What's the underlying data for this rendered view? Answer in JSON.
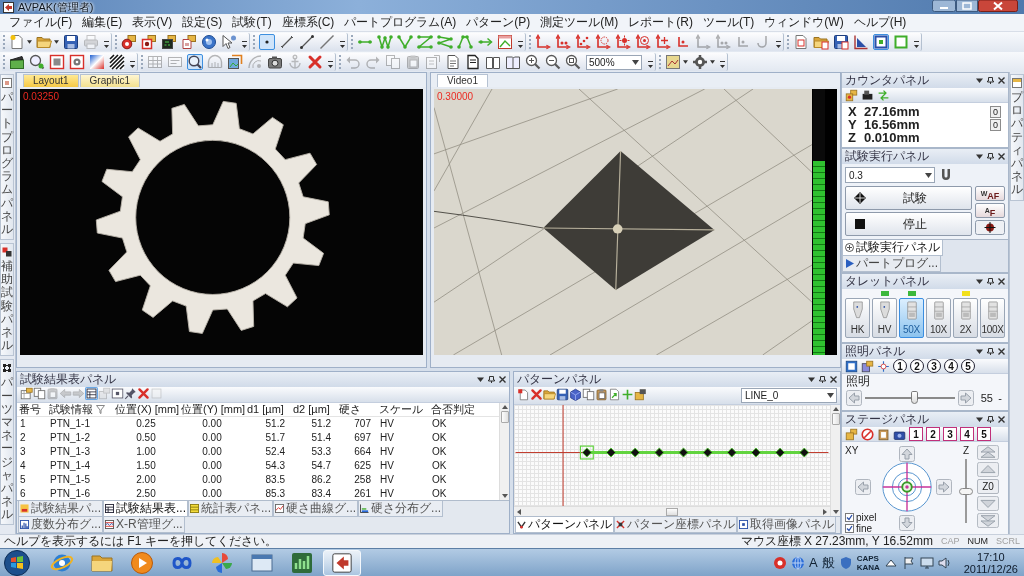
{
  "window": {
    "title": "AVPAK(管理者)"
  },
  "menu": [
    "ファイル(F)",
    "編集(E)",
    "表示(V)",
    "設定(S)",
    "試験(T)",
    "座標系(C)",
    "パートプログラム(A)",
    "パターン(P)",
    "測定ツール(M)",
    "レポート(R)",
    "ツール(T)",
    "ウィンドウ(W)",
    "ヘルプ(H)"
  ],
  "toolbars": [
    {
      "buttons": [
        {
          "selected": false,
          "disabled": false
        },
        {
          "selected": false,
          "disabled": false
        },
        {
          "selected": false,
          "disabled": false
        },
        {
          "selected": false,
          "disabled": true
        },
        {
          "selected": false,
          "disabled": false
        },
        {
          "selected": false,
          "disabled": false
        },
        {
          "selected": false,
          "disabled": false
        },
        {
          "selected": false,
          "disabled": false
        },
        {
          "selected": false,
          "disabled": false
        },
        {
          "selected": false,
          "disabled": false
        },
        {
          "selected": true,
          "disabled": false
        },
        {
          "selected": false,
          "disabled": false
        },
        {
          "selected": false,
          "disabled": false
        },
        {
          "selected": false,
          "disabled": false
        },
        {
          "selected": false,
          "disabled": false
        },
        {
          "selected": false,
          "disabled": false
        },
        {
          "selected": false,
          "disabled": false
        },
        {
          "selected": false,
          "disabled": false
        },
        {
          "selected": false,
          "disabled": false
        },
        {
          "selected": false,
          "disabled": false
        },
        {
          "selected": false,
          "disabled": false
        },
        {
          "selected": false,
          "disabled": false
        },
        {
          "selected": false,
          "disabled": false
        },
        {
          "selected": false,
          "disabled": false
        },
        {
          "selected": false,
          "disabled": false
        },
        {
          "selected": false,
          "disabled": false
        },
        {
          "selected": false,
          "disabled": false
        },
        {
          "selected": false,
          "disabled": false
        },
        {
          "selected": false,
          "disabled": false
        },
        {
          "selected": false,
          "disabled": false
        },
        {
          "selected": false,
          "disabled": true
        },
        {
          "selected": false,
          "disabled": true
        },
        {
          "selected": false,
          "disabled": true
        },
        {
          "selected": false,
          "disabled": true
        },
        {
          "selected": false,
          "disabled": false
        },
        {
          "selected": false,
          "disabled": false
        },
        {
          "selected": false,
          "disabled": false
        },
        {
          "selected": false,
          "disabled": false
        },
        {
          "selected": true,
          "disabled": false
        },
        {
          "selected": false,
          "disabled": false
        }
      ]
    },
    {
      "buttons": [
        {
          "selected": false,
          "disabled": false
        },
        {
          "selected": false,
          "disabled": false
        },
        {
          "selected": false,
          "disabled": false
        },
        {
          "selected": false,
          "disabled": false
        },
        {
          "selected": false,
          "disabled": false
        },
        {
          "selected": false,
          "disabled": false
        },
        {
          "selected": false,
          "disabled": true
        },
        {
          "selected": false,
          "disabled": true
        },
        {
          "selected": true,
          "disabled": false
        },
        {
          "selected": false,
          "disabled": true
        },
        {
          "selected": false,
          "disabled": false
        },
        {
          "selected": false,
          "disabled": true
        },
        {
          "selected": false,
          "disabled": false
        },
        {
          "selected": false,
          "disabled": true
        },
        {
          "selected": false,
          "disabled": false
        },
        {
          "selected": false,
          "disabled": true
        },
        {
          "selected": false,
          "disabled": true
        },
        {
          "selected": false,
          "disabled": true
        },
        {
          "selected": false,
          "disabled": true
        },
        {
          "selected": false,
          "disabled": true
        },
        {
          "selected": false,
          "disabled": false
        },
        {
          "selected": false,
          "disabled": false
        },
        {
          "selected": false,
          "disabled": false
        },
        {
          "selected": false,
          "disabled": false
        },
        {
          "selected": false,
          "disabled": false
        },
        {
          "selected": false,
          "disabled": false
        },
        {
          "selected": false,
          "disabled": false
        },
        {
          "selected": false,
          "disabled": false
        },
        {
          "selected": false,
          "disabled": false
        }
      ],
      "zoom_select": {
        "value": "500%"
      }
    }
  ],
  "left_dock": {
    "tabs": [
      {
        "label": "パートプログラムパネル"
      },
      {
        "label": "補助試験パネル"
      },
      {
        "label": "パーツマネージャパネル"
      }
    ]
  },
  "right_dock": {
    "tabs": [
      {
        "label": "プロパティパネル"
      }
    ]
  },
  "image_window": {
    "focused": true,
    "tabs": [
      {
        "label": "Layout1",
        "selected": true
      },
      {
        "label": "Graphic1",
        "selected": false
      }
    ],
    "readout": "0.03250"
  },
  "video_window": {
    "focused": false,
    "tabs": [
      {
        "label": "Video1",
        "selected": true
      }
    ],
    "readout": "0.30000",
    "focus_meter": {
      "level": 0.73
    }
  },
  "counter_panel": {
    "title": "カウンタパネル",
    "axes": [
      {
        "axis": "X",
        "value": "27.16mm",
        "reset": "0"
      },
      {
        "axis": "Y",
        "value": "16.56mm",
        "reset": "0"
      },
      {
        "axis": "Z",
        "value": "0.010mm"
      }
    ]
  },
  "test_panel": {
    "title": "試験実行パネル",
    "load_select": {
      "value": "0.3"
    },
    "actions": [
      {
        "kind": "start",
        "label": "試験"
      },
      {
        "kind": "stop",
        "label": "停止"
      }
    ],
    "af_buttons": [
      {
        "label": "$^{W}$AF"
      },
      {
        "label": "$^{A}$F"
      }
    ],
    "tabs": [
      {
        "label": "試験実行パネル",
        "selected": true
      },
      {
        "label": "パートプログ...",
        "selected": false
      }
    ]
  },
  "turret_panel": {
    "title": "タレットパネル",
    "positions": [
      {
        "kind": "indenter",
        "label": "HK",
        "selected": false
      },
      {
        "kind": "indenter",
        "label": "HV",
        "selected": false,
        "color": "#3cb83c"
      },
      {
        "kind": "lens",
        "label": "50X",
        "selected": true,
        "color": "#3cb83c"
      },
      {
        "kind": "lens",
        "label": "10X",
        "selected": false
      },
      {
        "kind": "lens",
        "label": "2X",
        "selected": false,
        "color": "#f2e01c"
      },
      {
        "kind": "lens",
        "label": "100X",
        "selected": false
      }
    ]
  },
  "lighting_panel": {
    "title": "照明パネル",
    "presets": [
      "1",
      "2",
      "3",
      "4",
      "5"
    ],
    "label": "照明",
    "slider": {
      "level": 0.55
    },
    "reading": "55",
    "suffix": "-"
  },
  "stage_panel": {
    "title": "ステージパネル",
    "presets": [
      "1",
      "2",
      "3",
      "4",
      "5"
    ],
    "xy_label": "XY",
    "z_label": "Z",
    "z_zero": "Z0",
    "z_slider": {
      "level": 0.5
    },
    "options": [
      {
        "label": "pixel",
        "checked": true
      },
      {
        "label": "fine",
        "checked": true
      }
    ]
  },
  "results_panel": {
    "title": "試験結果表パネル",
    "toolbar": [
      {
        "selected": false,
        "disabled": false
      },
      {
        "selected": false,
        "disabled": false
      },
      {
        "selected": false,
        "disabled": true
      },
      {
        "selected": false,
        "disabled": true
      },
      {
        "selected": false,
        "disabled": true
      },
      {
        "selected": true,
        "disabled": false
      },
      {
        "selected": false,
        "disabled": true
      },
      {
        "selected": false,
        "disabled": false
      },
      {
        "selected": false,
        "disabled": false
      },
      {
        "selected": false,
        "disabled": false
      },
      {
        "selected": false,
        "disabled": true
      }
    ],
    "columns": [
      {
        "label": "番号",
        "filter": false
      },
      {
        "label": "試験情報",
        "filter": true
      },
      {
        "label": "位置(X) [mm]",
        "filter": false
      },
      {
        "label": "位置(Y) [mm]",
        "filter": false
      },
      {
        "label": "d1 [µm]",
        "filter": false
      },
      {
        "label": "d2 [µm]",
        "filter": false
      },
      {
        "label": "硬さ",
        "filter": false
      },
      {
        "label": "スケール",
        "filter": false
      },
      {
        "label": "合否判定",
        "filter": false
      }
    ],
    "rows": [
      [
        "1",
        "PTN_1-1",
        "0.25",
        "0.00",
        "51.2",
        "51.2",
        "707",
        "HV",
        "OK"
      ],
      [
        "2",
        "PTN_1-2",
        "0.50",
        "0.00",
        "51.7",
        "51.4",
        "697",
        "HV",
        "OK"
      ],
      [
        "3",
        "PTN_1-3",
        "1.00",
        "0.00",
        "52.4",
        "53.3",
        "664",
        "HV",
        "OK"
      ],
      [
        "4",
        "PTN_1-4",
        "1.50",
        "0.00",
        "54.3",
        "54.7",
        "625",
        "HV",
        "OK"
      ],
      [
        "5",
        "PTN_1-5",
        "2.00",
        "0.00",
        "83.5",
        "86.2",
        "258",
        "HV",
        "OK"
      ],
      [
        "6",
        "PTN_1-6",
        "2.50",
        "0.00",
        "85.3",
        "83.4",
        "261",
        "HV",
        "OK"
      ]
    ],
    "tabs": [
      {
        "label": "試験結果パ...",
        "selected": false
      },
      {
        "label": "試験結果表...",
        "selected": true
      },
      {
        "label": "統計表パネ...",
        "selected": false
      },
      {
        "label": "硬さ曲線グ...",
        "selected": false
      },
      {
        "label": "硬さ分布グ...",
        "selected": false
      },
      {
        "label": "度数分布グ...",
        "selected": false
      },
      {
        "label": "X-R管理グ...",
        "selected": false
      }
    ]
  },
  "pattern_panel": {
    "title": "パターンパネル",
    "toolbar": [
      {
        "selected": false,
        "disabled": false
      },
      {
        "selected": false,
        "disabled": false
      },
      {
        "selected": false,
        "disabled": false
      },
      {
        "selected": false,
        "disabled": false
      },
      {
        "selected": false,
        "disabled": false
      },
      {
        "selected": false,
        "disabled": false
      },
      {
        "selected": false,
        "disabled": false
      },
      {
        "selected": false,
        "disabled": false
      },
      {
        "selected": false,
        "disabled": false
      },
      {
        "selected": false,
        "disabled": false
      }
    ],
    "line_select": {
      "value": "LINE_0"
    },
    "points": [
      {
        "selected": true
      },
      {
        "selected": false
      },
      {
        "selected": false
      },
      {
        "selected": false
      },
      {
        "selected": false
      },
      {
        "selected": false
      },
      {
        "selected": false
      },
      {
        "selected": false
      },
      {
        "selected": false
      },
      {
        "selected": false
      }
    ],
    "tabs": [
      {
        "label": "パターンパネル",
        "selected": true
      },
      {
        "label": "パターン座標パネル",
        "selected": false
      },
      {
        "label": "取得画像パネル",
        "selected": false
      }
    ]
  },
  "status_bar": {
    "message": "ヘルプを表示するには F1 キーを押してください。",
    "mouse_position": "マウス座標 X 27.23mm, Y 16.52mm",
    "indicators": [
      {
        "label": "CAP",
        "on": false
      },
      {
        "label": "NUM",
        "on": true
      },
      {
        "label": "SCRL",
        "on": false
      }
    ]
  },
  "taskbar": {
    "apps": [
      {
        "selected": false
      },
      {
        "selected": false
      },
      {
        "selected": false
      },
      {
        "selected": false
      },
      {
        "selected": false
      },
      {
        "selected": false
      },
      {
        "selected": false
      },
      {
        "selected": true
      }
    ],
    "ime": [
      "A",
      "般"
    ],
    "ime_status": [
      "CAPS",
      "KANA"
    ],
    "time": "17:10",
    "date": "2011/12/26"
  }
}
